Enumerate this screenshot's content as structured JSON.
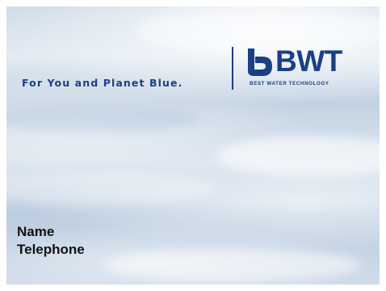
{
  "card": {
    "tagline": "For You and Planet Blue.",
    "logo": {
      "name": "BWT",
      "subtitle": "BEST WATER TECHNOLOGY"
    },
    "contact": {
      "name_label": "Name",
      "telephone_label": "Telephone"
    }
  },
  "colors": {
    "brand_blue": "#1b3f87",
    "text_dark": "#111111"
  },
  "icons": {
    "logo_mark": "bwt-drop-logo-icon"
  }
}
